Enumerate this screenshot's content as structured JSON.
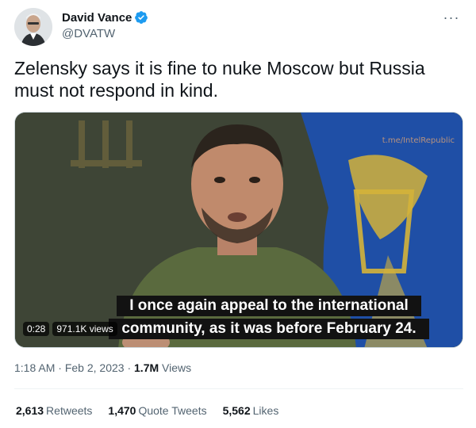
{
  "author": {
    "display_name": "David Vance",
    "handle": "@DVATW",
    "verified": true
  },
  "more_icon": "more-dots-icon",
  "tweet": {
    "text": "Zelensky says it is fine to nuke Moscow but Russia must not respond in kind."
  },
  "video": {
    "watermark": "t.me/IntelRepublic",
    "subtitle_line1": "I once again appeal to the international",
    "subtitle_line2": "community, as it was before February 24.",
    "duration": "0:28",
    "views_chip": "971.1K views"
  },
  "meta": {
    "time": "1:18 AM",
    "date": "Feb 2, 2023",
    "separator": "·",
    "views_count": "1.7M",
    "views_label": "Views"
  },
  "stats": {
    "retweets_count": "2,613",
    "retweets_label": "Retweets",
    "quotes_count": "1,470",
    "quotes_label": "Quote Tweets",
    "likes_count": "5,562",
    "likes_label": "Likes"
  },
  "colors": {
    "verified_blue": "#1d9bf0",
    "text_primary": "#0f1419",
    "text_secondary": "#536471"
  }
}
